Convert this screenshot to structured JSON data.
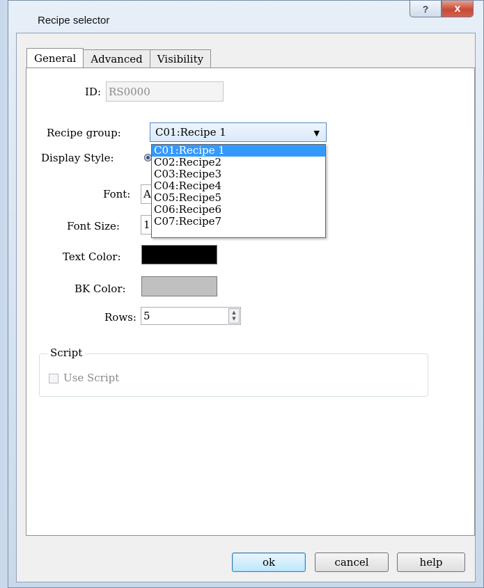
{
  "window": {
    "title": "Recipe selector",
    "help_icon": "question-mark-icon",
    "close_icon": "close-x-icon",
    "help_glyph": "?",
    "close_glyph": "x"
  },
  "tabs": [
    {
      "label": "General"
    },
    {
      "label": "Advanced"
    },
    {
      "label": "Visibility"
    }
  ],
  "form": {
    "id_label": "ID:",
    "id_value": "RS0000",
    "recipe_group_label": "Recipe group:",
    "recipe_group_value": "C01:Recipe 1",
    "recipe_group_options": [
      "C01:Recipe 1",
      "C02:Recipe2",
      "C03:Recipe3",
      "C04:Recipe4",
      "C05:Recipe5",
      "C06:Recipe6",
      "C07:Recipe7"
    ],
    "display_style_label": "Display Style:",
    "font_label": "Font:",
    "font_value": "A",
    "font_size_label": "Font Size:",
    "font_size_value": "1",
    "text_color_label": "Text Color:",
    "text_color": "#000000",
    "bk_color_label": "BK Color:",
    "bk_color": "#c0c0c0",
    "rows_label": "Rows:",
    "rows_value": "5"
  },
  "script_group": {
    "title": "Script",
    "use_script_label": "Use Script",
    "use_script_checked": false
  },
  "buttons": {
    "ok": "ok",
    "cancel": "cancel",
    "help": "help"
  }
}
